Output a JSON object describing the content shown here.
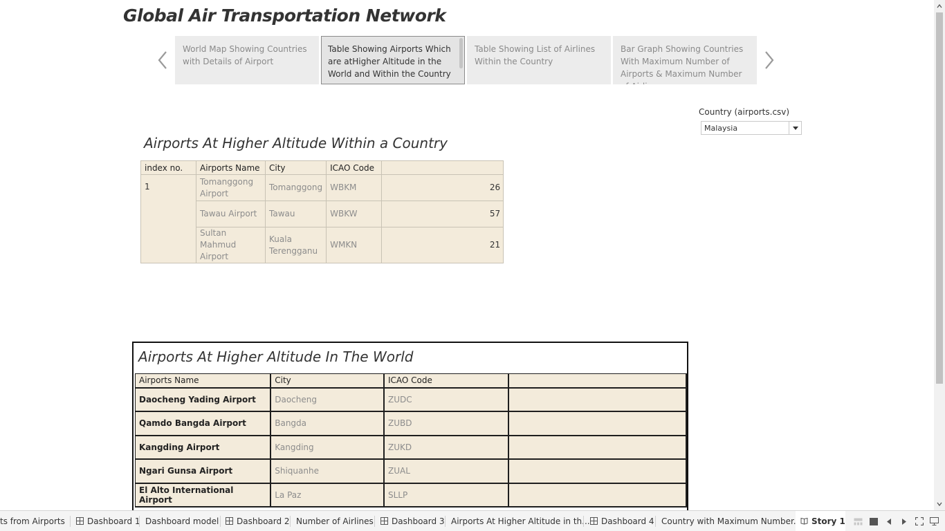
{
  "story": {
    "title": "Global Air Transportation Network",
    "points": [
      {
        "label": "World Map Showing Countries with Details of Airport"
      },
      {
        "label": "Table Showing Airports Which are atHigher Altitude in the World and Within the Country"
      },
      {
        "label": "Table Showing List of Airlines Within the Country"
      },
      {
        "label": "Bar Graph Showing Countries With Maximum Number of Airports & Maximum Number of Airlines"
      }
    ]
  },
  "filter": {
    "title": "Country (airports.csv)",
    "value": "Malaysia"
  },
  "country_table": {
    "title": "Airports At Higher Altitude Within a Country",
    "headers": [
      "index no.",
      "Airports Name",
      "City",
      "ICAO Code",
      ""
    ],
    "index": "1",
    "rows": [
      {
        "name": "Tomanggong Airport",
        "city": "Tomanggong",
        "icao": "WBKM",
        "value": "26"
      },
      {
        "name": "Tawau Airport",
        "city": "Tawau",
        "icao": "WBKW",
        "value": "57"
      },
      {
        "name": "Sultan Mahmud Airport",
        "city": "Kuala Terengganu",
        "icao": "WMKN",
        "value": "21"
      }
    ]
  },
  "world_table": {
    "title": "Airports At Higher Altitude In The World",
    "headers": [
      "Airports Name",
      "City",
      "ICAO Code",
      ""
    ],
    "rows": [
      {
        "name": "Daocheng Yading Airport",
        "city": "Daocheng",
        "icao": "ZUDC"
      },
      {
        "name": "Qamdo Bangda Airport",
        "city": "Bangda",
        "icao": "ZUBD"
      },
      {
        "name": "Kangding Airport",
        "city": "Kangding",
        "icao": "ZUKD"
      },
      {
        "name": "Ngari Gunsa Airport",
        "city": "Shiquanhe",
        "icao": "ZUAL"
      },
      {
        "name": "El Alto International Airport",
        "city": "La Paz",
        "icao": "SLLP"
      }
    ]
  },
  "tabs": [
    {
      "label": "ts from Airports",
      "icon": ""
    },
    {
      "label": "Dashboard 1",
      "icon": "dashboard-icon"
    },
    {
      "label": "Dashboard model",
      "icon": ""
    },
    {
      "label": "Dashboard 2",
      "icon": "dashboard-icon"
    },
    {
      "label": "Number of Airlines",
      "icon": ""
    },
    {
      "label": "Dashboard 3",
      "icon": "dashboard-icon"
    },
    {
      "label": "Airports At Higher Altitude in th...",
      "icon": ""
    },
    {
      "label": "Dashboard 4",
      "icon": "dashboard-icon"
    },
    {
      "label": "Country with Maximum Number...",
      "icon": ""
    },
    {
      "label": "Story 1",
      "icon": "story-icon"
    }
  ],
  "colors": {
    "table_bg": "#f3ebdb",
    "story_point_bg": "#ececec",
    "muted_text": "#8c8c8c"
  }
}
